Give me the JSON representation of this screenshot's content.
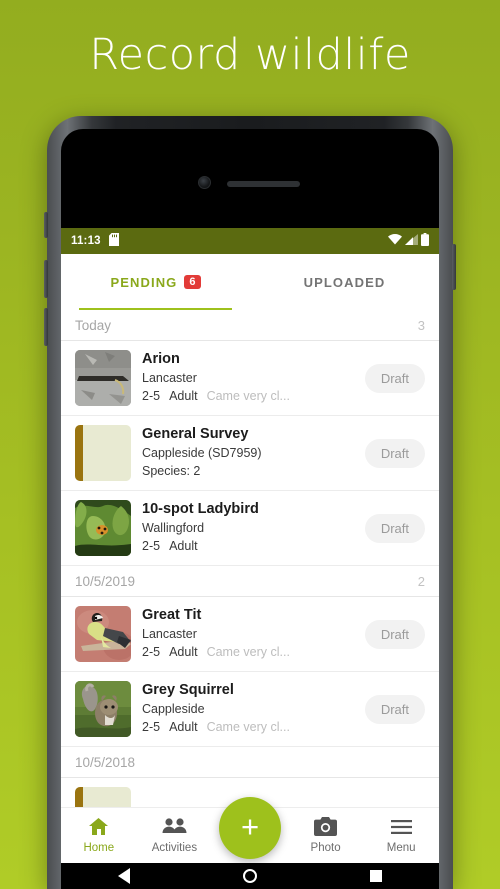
{
  "hero": {
    "title": "Record wildlife"
  },
  "status_bar": {
    "time": "11:13",
    "icons": [
      "sd-card-icon",
      "wifi-icon",
      "signal-icon",
      "battery-icon"
    ],
    "background_color": "#5b6a10"
  },
  "tabs": [
    {
      "label": "PENDING",
      "badge": "6",
      "active": true
    },
    {
      "label": "UPLOADED",
      "badge": "",
      "active": false
    }
  ],
  "accent_color": "#9ec11c",
  "badge_color": "#e23b38",
  "groups": [
    {
      "date": "Today",
      "count": "3",
      "items": [
        {
          "title": "Arion",
          "location": "Lancaster",
          "count_range": "2-5",
          "stage": "Adult",
          "note": "Came very cl...",
          "status": "Draft",
          "thumb": "slug-photo"
        },
        {
          "title": "General Survey",
          "location": "Cappleside (SD7959)",
          "count_range": "Species: 2",
          "stage": "",
          "note": "",
          "status": "Draft",
          "thumb": "survey-placeholder"
        },
        {
          "title": "10-spot Ladybird",
          "location": "Wallingford",
          "count_range": "2-5",
          "stage": "Adult",
          "note": "",
          "status": "Draft",
          "thumb": "ladybird-photo"
        }
      ]
    },
    {
      "date": "10/5/2019",
      "count": "2",
      "items": [
        {
          "title": "Great Tit",
          "location": "Lancaster",
          "count_range": "2-5",
          "stage": "Adult",
          "note": "Came very cl...",
          "status": "Draft",
          "thumb": "greattit-photo"
        },
        {
          "title": "Grey Squirrel",
          "location": "Cappleside",
          "count_range": "2-5",
          "stage": "Adult",
          "note": "Came very cl...",
          "status": "Draft",
          "thumb": "squirrel-photo"
        }
      ]
    },
    {
      "date": "10/5/2018",
      "count": "",
      "items": []
    }
  ],
  "bottom_nav": {
    "items": [
      {
        "label": "Home",
        "icon": "home-icon",
        "active": true
      },
      {
        "label": "Activities",
        "icon": "people-icon",
        "active": false
      },
      {
        "label": "Photo",
        "icon": "camera-icon",
        "active": false
      },
      {
        "label": "Menu",
        "icon": "hamburger-icon",
        "active": false
      }
    ],
    "fab": {
      "icon": "plus-icon",
      "label": "+"
    }
  },
  "system_bar": {
    "buttons": [
      "back-button",
      "home-button",
      "recents-button"
    ]
  }
}
